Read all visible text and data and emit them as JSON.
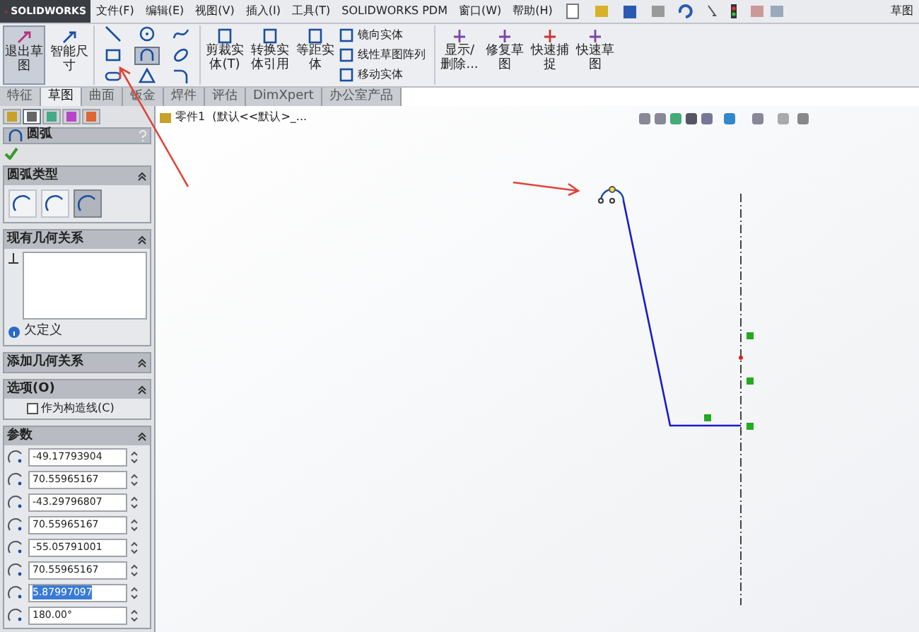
{
  "app": {
    "logo": "SOLIDWORKS",
    "mode": "草图"
  },
  "menu": [
    "文件(F)",
    "编辑(E)",
    "视图(V)",
    "插入(I)",
    "工具(T)",
    "SOLIDWORKS PDM",
    "窗口(W)",
    "帮助(H)"
  ],
  "ribbon": {
    "big_left": [
      {
        "label": "退出草图",
        "selected": true
      },
      {
        "label": "智能尺寸",
        "selected": false
      }
    ],
    "sketch_tools": [
      {
        "kind": "line",
        "selected": false
      },
      {
        "kind": "circle",
        "selected": false
      },
      {
        "kind": "spline",
        "selected": false
      },
      {
        "kind": "rect",
        "selected": false
      },
      {
        "kind": "arc",
        "selected": true
      },
      {
        "kind": "ellipse",
        "selected": false
      },
      {
        "kind": "slot",
        "selected": false
      },
      {
        "kind": "polygon",
        "selected": false
      },
      {
        "kind": "fillet",
        "selected": false
      }
    ],
    "big_mid": [
      "剪裁实体(T)",
      "转换实体引用",
      "等距实体"
    ],
    "small": [
      "镜向实体",
      "线性草图阵列",
      "移动实体"
    ],
    "big_right": [
      "显示/删除...",
      "修复草图",
      "快速捕捉",
      "快速草图"
    ]
  },
  "tabs": [
    {
      "label": "特征",
      "selected": false
    },
    {
      "label": "草图",
      "selected": true
    },
    {
      "label": "曲面",
      "selected": false
    },
    {
      "label": "钣金",
      "selected": false
    },
    {
      "label": "焊件",
      "selected": false
    },
    {
      "label": "评估",
      "selected": false
    },
    {
      "label": "DimXpert",
      "selected": false
    },
    {
      "label": "办公室产品",
      "selected": false
    }
  ],
  "panel_tabs": [
    {
      "selected": false
    },
    {
      "selected": true
    },
    {
      "selected": false
    },
    {
      "selected": false
    },
    {
      "selected": false
    }
  ],
  "feature_tree": {
    "item": "零件1  (默认<<默认>_..."
  },
  "property_manager": {
    "title": "圆弧",
    "arc_type": {
      "title": "圆弧类型",
      "options": [
        {
          "selected": false
        },
        {
          "selected": false
        },
        {
          "selected": true
        }
      ]
    },
    "relations": {
      "title": "现有几何关系",
      "status": "欠定义"
    },
    "add_relations": {
      "title": "添加几何关系"
    },
    "options": {
      "title": "选项(O)",
      "checkbox": {
        "label": "作为构造线(C)",
        "checked": false
      }
    },
    "parameters": {
      "title": "参数",
      "fields": [
        {
          "value": "-49.17793904",
          "selected": false
        },
        {
          "value": "70.55965167",
          "selected": false
        },
        {
          "value": "-43.29796807",
          "selected": false
        },
        {
          "value": "70.55965167",
          "selected": false
        },
        {
          "value": "-55.05791001",
          "selected": false
        },
        {
          "value": "70.55965167",
          "selected": false
        },
        {
          "value": "5.87997097",
          "selected": true
        },
        {
          "value": "180.00°",
          "selected": false
        }
      ]
    }
  }
}
